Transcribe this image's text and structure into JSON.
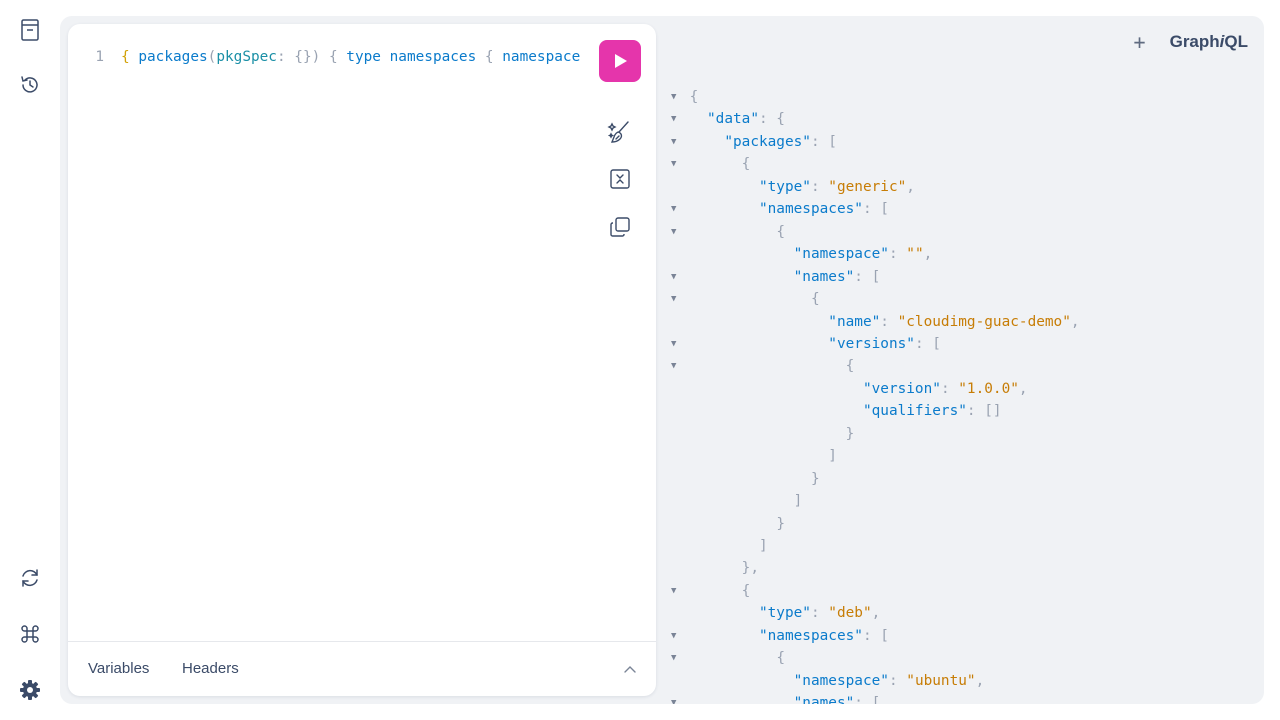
{
  "sidebar": {
    "items": [
      {
        "name": "docs",
        "icon": "docs-icon"
      },
      {
        "name": "history",
        "icon": "history-icon"
      },
      {
        "name": "refetch-schema",
        "icon": "refresh-icon"
      },
      {
        "name": "shortcuts",
        "icon": "command-icon"
      },
      {
        "name": "settings",
        "icon": "gear-icon"
      }
    ]
  },
  "editor": {
    "line_number": "1",
    "query_tokens": [
      {
        "t": "{",
        "c": "tok-brace"
      },
      {
        "t": " ",
        "c": ""
      },
      {
        "t": "packages",
        "c": "tok-field"
      },
      {
        "t": "(",
        "c": "tok-punct"
      },
      {
        "t": "pkgSpec",
        "c": "tok-arg"
      },
      {
        "t": ": {}) { ",
        "c": "tok-punct"
      },
      {
        "t": "type",
        "c": "tok-field"
      },
      {
        "t": " ",
        "c": ""
      },
      {
        "t": "namespaces",
        "c": "tok-field"
      },
      {
        "t": " { ",
        "c": "tok-punct"
      },
      {
        "t": "namespace",
        "c": "tok-field"
      }
    ],
    "footer": {
      "variables_label": "Variables",
      "headers_label": "Headers"
    },
    "run_color": "#e535ab"
  },
  "header": {
    "plus_label": "+",
    "logo_prefix": "Graph",
    "logo_italic": "i",
    "logo_suffix": "QL"
  },
  "result_lines": [
    {
      "fold": true,
      "indent": 0,
      "parts": [
        [
          "{",
          "j-pun"
        ]
      ]
    },
    {
      "fold": true,
      "indent": 1,
      "parts": [
        [
          "\"data\"",
          "j-key"
        ],
        [
          ": {",
          "j-pun"
        ]
      ]
    },
    {
      "fold": true,
      "indent": 2,
      "parts": [
        [
          "\"packages\"",
          "j-key"
        ],
        [
          ": [",
          "j-pun"
        ]
      ]
    },
    {
      "fold": true,
      "indent": 3,
      "parts": [
        [
          "{",
          "j-pun"
        ]
      ]
    },
    {
      "fold": false,
      "indent": 4,
      "parts": [
        [
          "\"type\"",
          "j-key"
        ],
        [
          ": ",
          "j-pun"
        ],
        [
          "\"generic\"",
          "j-str"
        ],
        [
          ",",
          "j-pun"
        ]
      ]
    },
    {
      "fold": true,
      "indent": 4,
      "parts": [
        [
          "\"namespaces\"",
          "j-key"
        ],
        [
          ": [",
          "j-pun"
        ]
      ]
    },
    {
      "fold": true,
      "indent": 5,
      "parts": [
        [
          "{",
          "j-pun"
        ]
      ]
    },
    {
      "fold": false,
      "indent": 6,
      "parts": [
        [
          "\"namespace\"",
          "j-key"
        ],
        [
          ": ",
          "j-pun"
        ],
        [
          "\"\"",
          "j-str"
        ],
        [
          ",",
          "j-pun"
        ]
      ]
    },
    {
      "fold": true,
      "indent": 6,
      "parts": [
        [
          "\"names\"",
          "j-key"
        ],
        [
          ": [",
          "j-pun"
        ]
      ]
    },
    {
      "fold": true,
      "indent": 7,
      "parts": [
        [
          "{",
          "j-pun"
        ]
      ]
    },
    {
      "fold": false,
      "indent": 8,
      "parts": [
        [
          "\"name\"",
          "j-key"
        ],
        [
          ": ",
          "j-pun"
        ],
        [
          "\"cloudimg-guac-demo\"",
          "j-str"
        ],
        [
          ",",
          "j-pun"
        ]
      ]
    },
    {
      "fold": true,
      "indent": 8,
      "parts": [
        [
          "\"versions\"",
          "j-key"
        ],
        [
          ": [",
          "j-pun"
        ]
      ]
    },
    {
      "fold": true,
      "indent": 9,
      "parts": [
        [
          "{",
          "j-pun"
        ]
      ]
    },
    {
      "fold": false,
      "indent": 10,
      "parts": [
        [
          "\"version\"",
          "j-key"
        ],
        [
          ": ",
          "j-pun"
        ],
        [
          "\"1.0.0\"",
          "j-str"
        ],
        [
          ",",
          "j-pun"
        ]
      ]
    },
    {
      "fold": false,
      "indent": 10,
      "parts": [
        [
          "\"qualifiers\"",
          "j-key"
        ],
        [
          ": []",
          "j-pun"
        ]
      ]
    },
    {
      "fold": false,
      "indent": 9,
      "parts": [
        [
          "}",
          "j-pun"
        ]
      ]
    },
    {
      "fold": false,
      "indent": 8,
      "parts": [
        [
          "]",
          "j-pun"
        ]
      ]
    },
    {
      "fold": false,
      "indent": 7,
      "parts": [
        [
          "}",
          "j-pun"
        ]
      ]
    },
    {
      "fold": false,
      "indent": 6,
      "parts": [
        [
          "]",
          "j-pun"
        ]
      ]
    },
    {
      "fold": false,
      "indent": 5,
      "parts": [
        [
          "}",
          "j-pun"
        ]
      ]
    },
    {
      "fold": false,
      "indent": 4,
      "parts": [
        [
          "]",
          "j-pun"
        ]
      ]
    },
    {
      "fold": false,
      "indent": 3,
      "parts": [
        [
          "},",
          "j-pun"
        ]
      ]
    },
    {
      "fold": true,
      "indent": 3,
      "parts": [
        [
          "{",
          "j-pun"
        ]
      ]
    },
    {
      "fold": false,
      "indent": 4,
      "parts": [
        [
          "\"type\"",
          "j-key"
        ],
        [
          ": ",
          "j-pun"
        ],
        [
          "\"deb\"",
          "j-str"
        ],
        [
          ",",
          "j-pun"
        ]
      ]
    },
    {
      "fold": true,
      "indent": 4,
      "parts": [
        [
          "\"namespaces\"",
          "j-key"
        ],
        [
          ": [",
          "j-pun"
        ]
      ]
    },
    {
      "fold": true,
      "indent": 5,
      "parts": [
        [
          "{",
          "j-pun"
        ]
      ]
    },
    {
      "fold": false,
      "indent": 6,
      "parts": [
        [
          "\"namespace\"",
          "j-key"
        ],
        [
          ": ",
          "j-pun"
        ],
        [
          "\"ubuntu\"",
          "j-str"
        ],
        [
          ",",
          "j-pun"
        ]
      ]
    },
    {
      "fold": true,
      "indent": 6,
      "parts": [
        [
          "\"names\"",
          "j-key"
        ],
        [
          ": [",
          "j-pun"
        ]
      ]
    }
  ]
}
